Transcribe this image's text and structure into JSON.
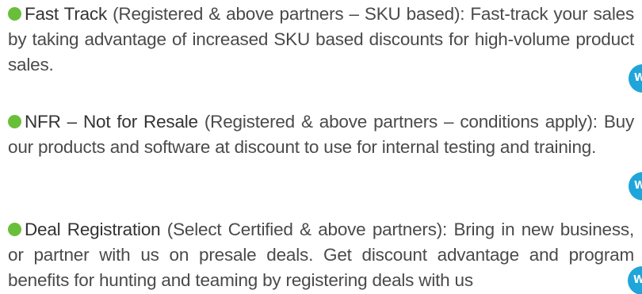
{
  "items": [
    {
      "title": "Fast Track",
      "text": " (Registered & above partners – SKU based): Fast-track your sales by taking advantage of increased SKU based discounts for high-volume product sales.",
      "badge": "WEB"
    },
    {
      "title": "NFR – Not for Resale",
      "text": " (Registered & above partners – conditions apply): Buy our products and software at discount to use for internal testing and training.",
      "badge": "WEB"
    },
    {
      "title": "Deal Registration",
      "text": " (Select Certified & above partners): Bring in new business, or partner with us on presale deals. Get discount advantage and program benefits for hunting and teaming by registering deals with us",
      "badge": "WEB"
    }
  ],
  "colors": {
    "bullet": "#6abf3a",
    "badge": "#1fa5d9",
    "text": "#4a4a4a"
  }
}
